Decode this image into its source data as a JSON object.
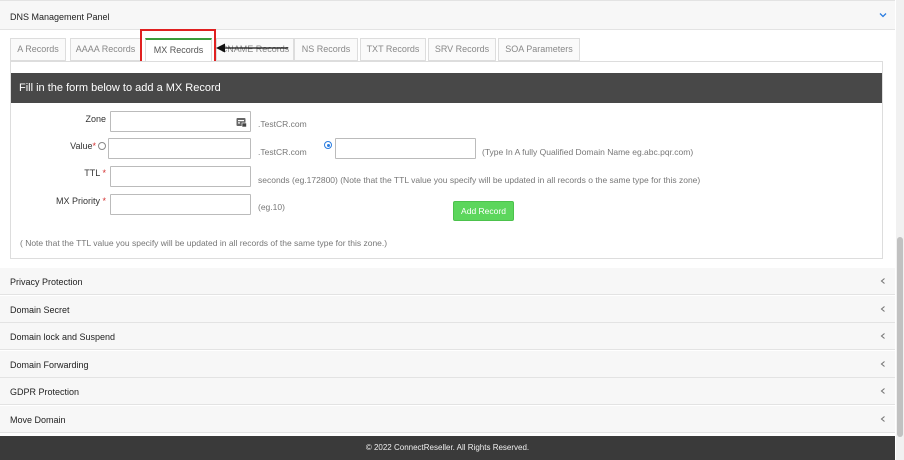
{
  "panel": {
    "title": "DNS Management Panel"
  },
  "tabs": [
    {
      "label": "A Records"
    },
    {
      "label": "AAAA Records"
    },
    {
      "label": "MX Records",
      "active": true
    },
    {
      "label": "CNAME Records"
    },
    {
      "label": "NS Records"
    },
    {
      "label": "TXT Records"
    },
    {
      "label": "SRV Records"
    },
    {
      "label": "SOA Parameters"
    }
  ],
  "form": {
    "heading": "Fill in the form below to add a MX Record",
    "zone_label": "Zone",
    "zone_suffix": ".TestCR.com",
    "value_label": "Value",
    "value_suffix": ".TestCR.com",
    "value_hint": "(Type In A fully Qualified Domain Name eg.abc.pqr.com)",
    "ttl_label": "TTL",
    "ttl_hint": "seconds (eg.172800) (Note that the TTL value you specify will be updated in all records o the same type for this zone)",
    "priority_label": "MX Priority",
    "priority_hint": "(eg.10)",
    "required_mark": "*",
    "add_button": "Add Record",
    "note": "( Note that the TTL value you specify will be updated in all records of the same type for this zone.)"
  },
  "accordion": [
    {
      "label": "Privacy Protection"
    },
    {
      "label": "Domain Secret"
    },
    {
      "label": "Domain lock and Suspend"
    },
    {
      "label": "Domain Forwarding"
    },
    {
      "label": "GDPR Protection"
    },
    {
      "label": "Move Domain"
    }
  ],
  "footer": {
    "text": "© 2022 ConnectReseller. All Rights Reserved."
  },
  "colors": {
    "active_tab_accent": "#3a9b3a",
    "header_bar": "#484848",
    "add_button": "#5cd65c",
    "highlight": "#e02020",
    "required": "#d32f2f"
  }
}
